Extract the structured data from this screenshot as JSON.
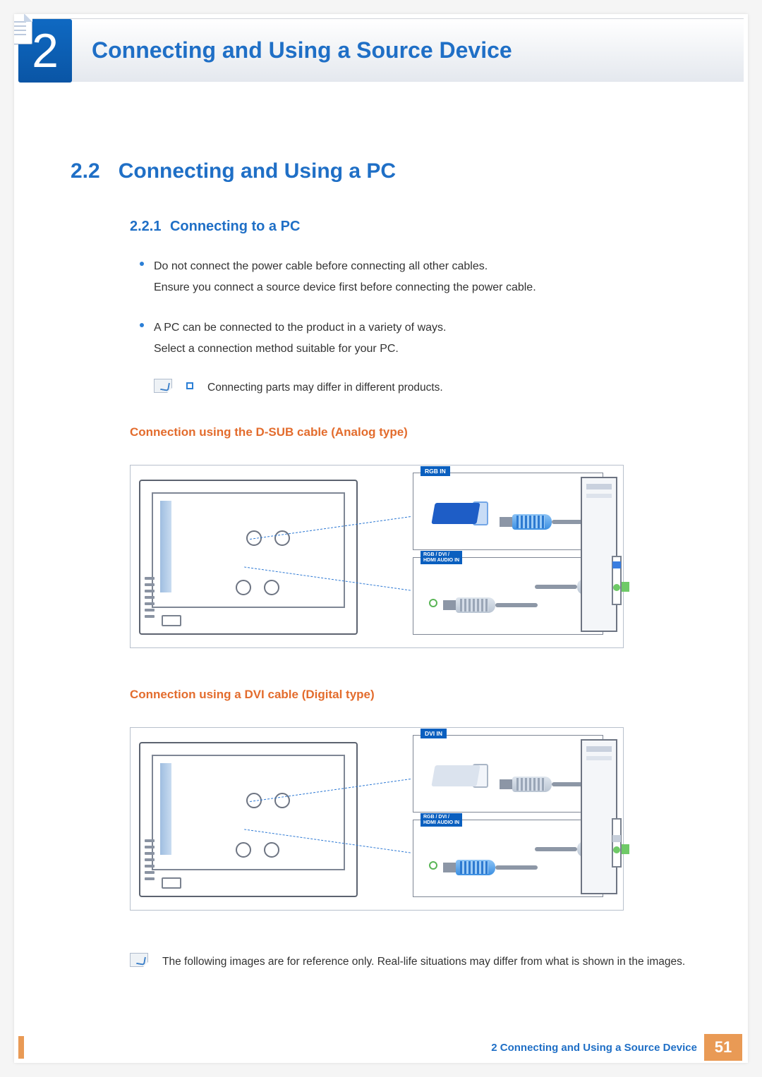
{
  "chapter": {
    "number": "2",
    "title": "Connecting and Using a Source Device"
  },
  "section": {
    "number": "2.2",
    "title": "Connecting and Using a PC"
  },
  "subsection": {
    "number": "2.2.1",
    "title": "Connecting to a PC"
  },
  "bullets": [
    {
      "l1": "Do not connect the power cable before connecting all other cables.",
      "l2": "Ensure you connect a source device first before connecting the power cable."
    },
    {
      "l1": "A PC can be connected to the product in a variety of ways.",
      "l2": "Select a connection method suitable for your PC."
    }
  ],
  "note1": "Connecting parts may differ in different products.",
  "note2": "The following images are for reference only. Real-life situations may differ from what is shown in the images.",
  "subheads": {
    "dsub": "Connection using the D-SUB cable (Analog type)",
    "dvi": "Connection using a DVI cable (Digital type)"
  },
  "port_labels": {
    "rgb_in": "RGB IN",
    "audio_in": "RGB / DVI /\nHDMI AUDIO IN",
    "dvi_in": "DVI IN"
  },
  "footer": {
    "text": "2 Connecting and Using a Source Device",
    "page": "51"
  }
}
